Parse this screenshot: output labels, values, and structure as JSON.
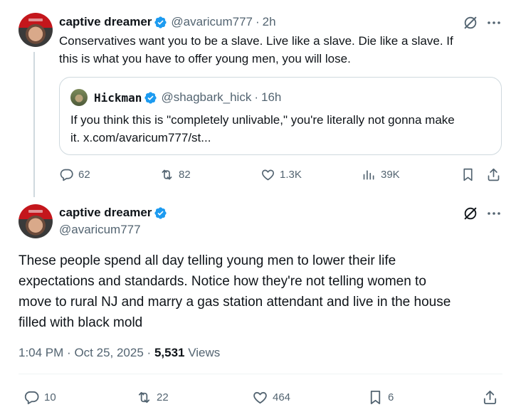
{
  "tweet1": {
    "display_name": "captive dreamer",
    "handle": "@avaricum777",
    "sep": "·",
    "time": "2h",
    "text_line1": "Conservatives want you to be a slave.  Live like a slave.  Die like a slave. If",
    "text_line2": "this is what you have to offer young men, you will lose.",
    "quote": {
      "display_name": "Hickman",
      "handle": "@shagbark_hick",
      "sep": "·",
      "time": "16h",
      "text_line1": "If you think this is \"completely unlivable,\" you're literally not gonna make",
      "text_line2": "it. x.com/avaricum777/st..."
    },
    "actions": {
      "replies": "62",
      "reposts": "82",
      "likes": "1.3K",
      "views": "39K"
    }
  },
  "tweet2": {
    "display_name": "captive dreamer",
    "handle": "@avaricum777",
    "text_lines": [
      "These people spend all day telling young men to lower their life",
      "expectations and standards.  Notice how they're not telling women to",
      "move to rural NJ and marry a gas station attendant and live in the house",
      "filled with black mold"
    ],
    "meta": {
      "time": "1:04 PM",
      "sep1": "·",
      "date": "Oct 25, 2025",
      "sep2": "·",
      "views_count": "5,531",
      "views_label": "Views"
    },
    "actions": {
      "replies": "10",
      "reposts": "22",
      "likes": "464",
      "bookmarks": "6"
    }
  },
  "colors": {
    "verified": "#1d9bf0",
    "secondary_text": "#536471",
    "primary_text": "#0f1419",
    "border": "#cfd9de"
  },
  "icons": [
    "grok-icon",
    "more-icon",
    "reply-icon",
    "repost-icon",
    "like-icon",
    "views-icon",
    "bookmark-icon",
    "share-icon",
    "verified-badge-icon"
  ]
}
